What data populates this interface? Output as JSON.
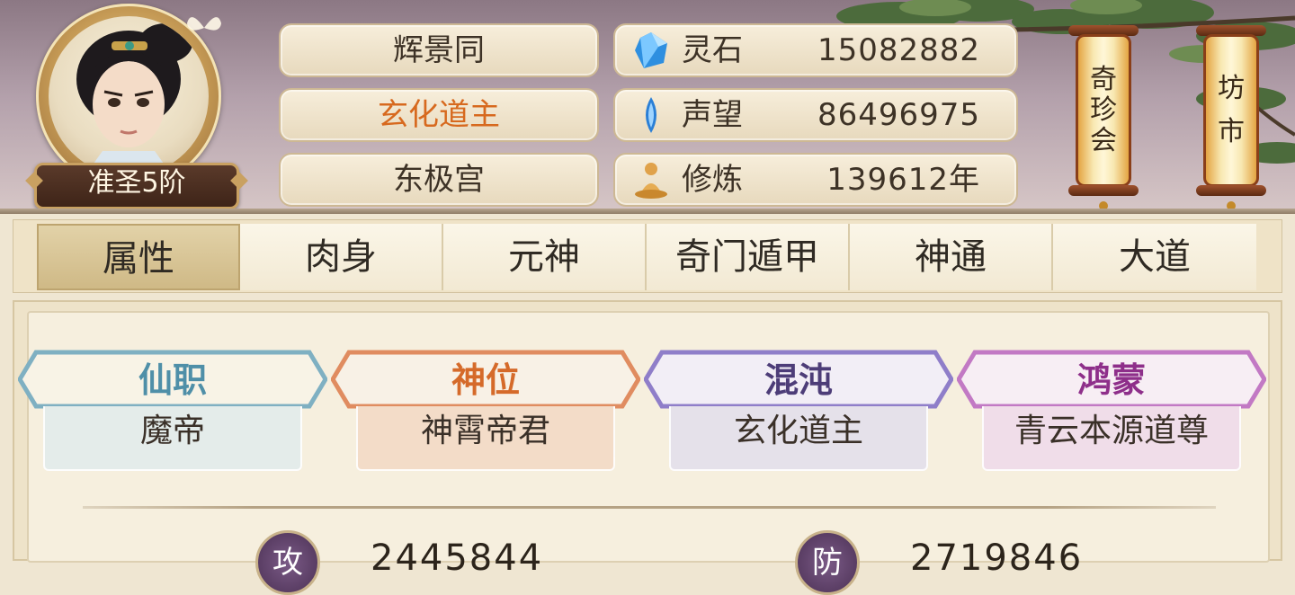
{
  "header": {
    "rank_badge": "准圣5阶",
    "info": [
      {
        "text": "辉景同",
        "style": "normal"
      },
      {
        "text": "玄化道主",
        "style": "accent"
      },
      {
        "text": "东极宫",
        "style": "normal"
      }
    ],
    "resources": [
      {
        "icon": "spirit-stone-icon",
        "label": "灵石",
        "value": "15082882"
      },
      {
        "icon": "reputation-crystal-icon",
        "label": "声望",
        "value": "86496975"
      },
      {
        "icon": "meditation-icon",
        "label": "修炼",
        "value": "139612年"
      }
    ],
    "scrolls": [
      {
        "chars": [
          "奇",
          "珍",
          "会"
        ]
      },
      {
        "chars": [
          "坊",
          "市"
        ]
      }
    ]
  },
  "tabs": [
    {
      "label": "属性",
      "active": true
    },
    {
      "label": "肉身",
      "active": false
    },
    {
      "label": "元神",
      "active": false
    },
    {
      "label": "奇门遁甲",
      "active": false
    },
    {
      "label": "神通",
      "active": false
    },
    {
      "label": "大道",
      "active": false
    }
  ],
  "titles": [
    {
      "heading": "仙职",
      "value": "魔帝",
      "color": "#4f8fa8",
      "frame": "#7fb0c2",
      "fill": "#e4ecea"
    },
    {
      "heading": "神位",
      "value": "神霄帝君",
      "color": "#d56a2a",
      "frame": "#e08c60",
      "fill": "#f3dcc8"
    },
    {
      "heading": "混沌",
      "value": "玄化道主",
      "color": "#4d3d78",
      "frame": "#8f7ec9",
      "fill": "#e5e1ea"
    },
    {
      "heading": "鸿蒙",
      "value": "青云本源道尊",
      "color": "#8e2f8a",
      "frame": "#c279c4",
      "fill": "#f0dde9"
    }
  ],
  "stats": [
    {
      "icon_char": "攻",
      "value": "2445844"
    },
    {
      "icon_char": "防",
      "value": "2719846"
    }
  ]
}
